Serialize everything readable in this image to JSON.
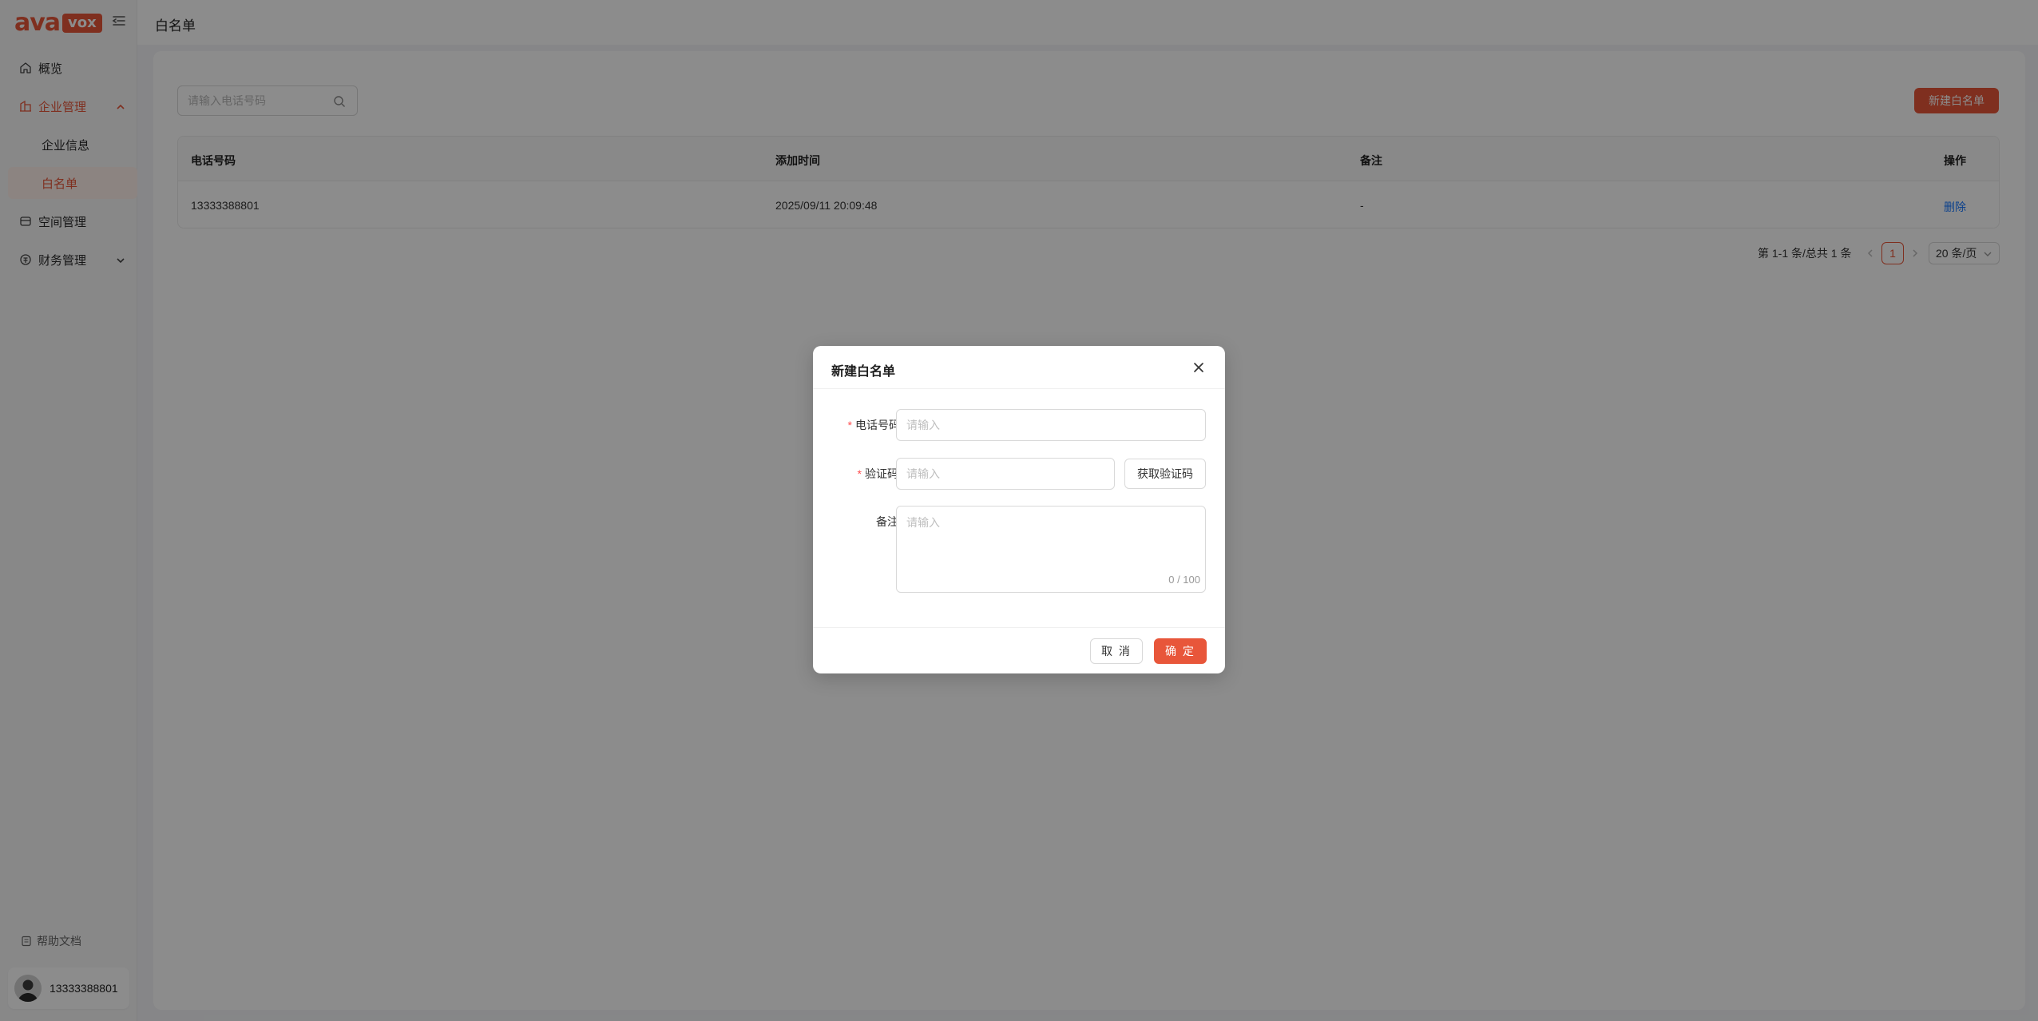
{
  "theme": {
    "accent": "#e8563a",
    "link": "#1677ff",
    "required": "#ff4d4f"
  },
  "brand": {
    "logo_text": "ava",
    "logo_badge": "vox"
  },
  "sidebar": {
    "items": [
      {
        "label": "概览",
        "icon": "home-icon"
      },
      {
        "label": "企业管理",
        "icon": "building-icon",
        "expanded": true
      },
      {
        "label": "企业信息"
      },
      {
        "label": "白名单",
        "selected": true
      },
      {
        "label": "空间管理",
        "icon": "space-icon"
      },
      {
        "label": "财务管理",
        "icon": "finance-icon",
        "expanded": false
      }
    ],
    "help_label": "帮助文档",
    "user_phone": "13333388801"
  },
  "header": {
    "title": "白名单"
  },
  "toolbar": {
    "search_placeholder": "请输入电话号码",
    "new_button": "新建白名单"
  },
  "table": {
    "columns": [
      "电话号码",
      "添加时间",
      "备注",
      "操作"
    ],
    "rows": [
      {
        "phone": "13333388801",
        "time": "2025/09/11 20:09:48",
        "note": "-",
        "action": "删除"
      }
    ]
  },
  "pagination": {
    "summary": "第 1-1 条/总共 1 条",
    "current_page": "1",
    "page_size": "20 条/页"
  },
  "modal": {
    "title": "新建白名单",
    "phone_label": "电话号码",
    "phone_placeholder": "请输入",
    "code_label": "验证码",
    "code_placeholder": "请输入",
    "get_code_button": "获取验证码",
    "note_label": "备注",
    "note_placeholder": "请输入",
    "note_counter": "0 / 100",
    "required_mark": "*",
    "cancel_button": "取 消",
    "ok_button": "确 定"
  }
}
